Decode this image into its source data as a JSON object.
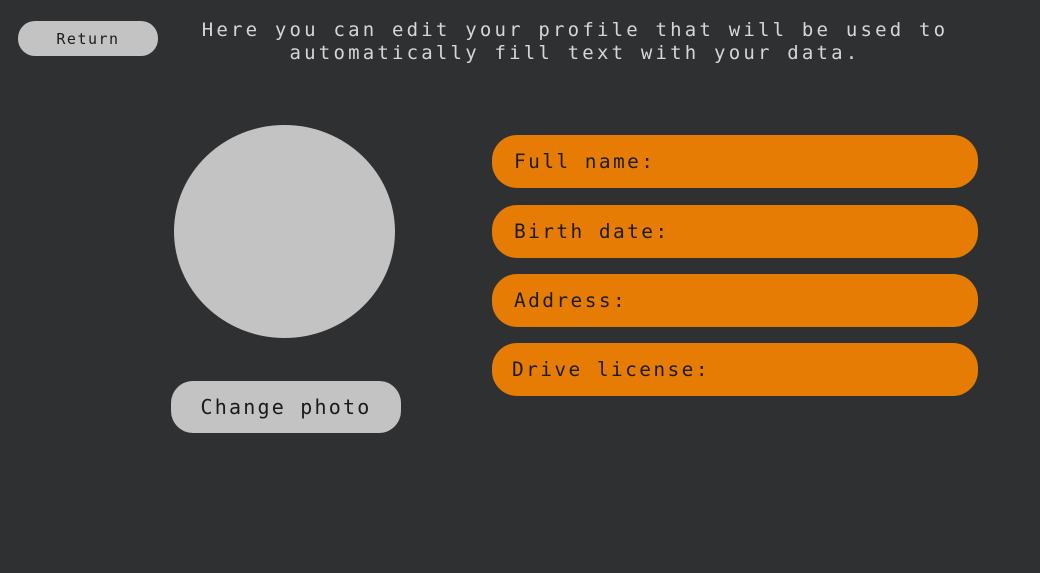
{
  "header": {
    "return_label": "Return",
    "instructions": "Here you can edit your profile that will be used to\nautomatically fill text with your data."
  },
  "profile": {
    "change_photo_label": "Change photo"
  },
  "fields": [
    {
      "label": "Full name:"
    },
    {
      "label": "Birth date:"
    },
    {
      "label": "Address:"
    },
    {
      "label": "Drive license:"
    }
  ],
  "colors": {
    "background": "#2f3032",
    "button_gray": "#c3c3c3",
    "field_orange": "#e67c04",
    "text_light": "#d6d6d6"
  }
}
